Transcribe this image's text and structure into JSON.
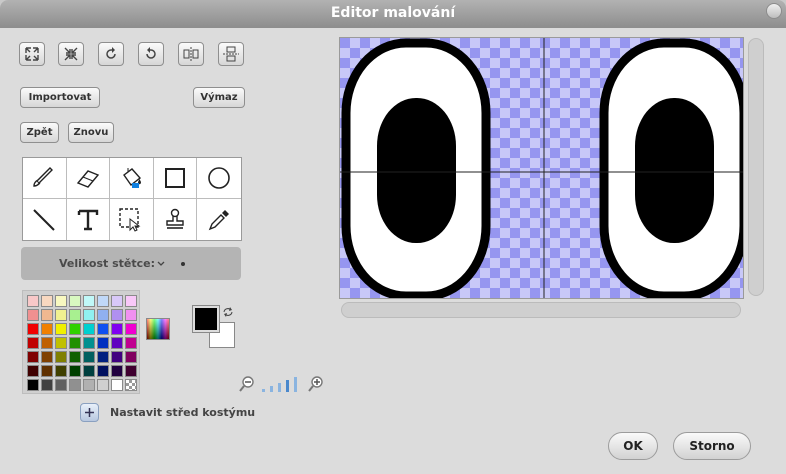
{
  "window": {
    "title": "Editor malování"
  },
  "actions": {
    "import_label": "Importovat",
    "clear_label": "Výmaz",
    "undo_label": "Zpět",
    "redo_label": "Znovu"
  },
  "brush": {
    "size_label": "Velikost stětce:"
  },
  "center": {
    "label": "Nastavit střed kostýmu"
  },
  "footer": {
    "ok_label": "OK",
    "cancel_label": "Storno"
  },
  "tools": [
    "brush-icon",
    "eraser-icon",
    "fill-icon",
    "rectangle-icon",
    "ellipse-icon",
    "line-icon",
    "text-icon",
    "select-icon",
    "stamp-icon",
    "eyedropper-icon"
  ],
  "colors": {
    "foreground": "#000000",
    "background": "#ffffff",
    "palette": [
      "#f8c8c8",
      "#f8d8c0",
      "#f8f8c0",
      "#d8f8c0",
      "#c0f8f8",
      "#c0d8f8",
      "#d8c8f8",
      "#f8c8f8",
      "#f09090",
      "#f0b890",
      "#f0f090",
      "#a8f090",
      "#90f0f0",
      "#90b0f0",
      "#b090f0",
      "#f090f0",
      "#f00000",
      "#f08000",
      "#f0f000",
      "#30d000",
      "#00d0d0",
      "#1050f0",
      "#8000f0",
      "#f000d0",
      "#c00000",
      "#c06000",
      "#c0c000",
      "#209000",
      "#009090",
      "#0030c0",
      "#6000c0",
      "#c00090",
      "#800000",
      "#804000",
      "#808000",
      "#106000",
      "#006060",
      "#002080",
      "#400080",
      "#800060",
      "#400000",
      "#603000",
      "#404000",
      "#004000",
      "#004040",
      "#001060",
      "#200040",
      "#400030",
      "#000000",
      "#404040",
      "#606060",
      "#909090",
      "#b0b0b0",
      "#d0d0d0",
      "#ffffff",
      "transparent"
    ]
  }
}
